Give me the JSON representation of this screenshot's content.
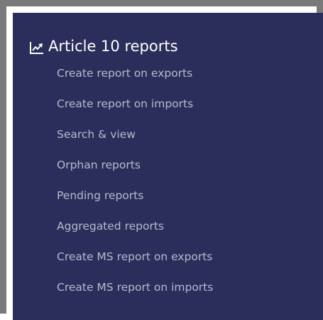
{
  "section": {
    "title": "Article 10 reports",
    "icon": "line-chart-icon"
  },
  "menu": {
    "items": [
      {
        "label": "Create report on exports"
      },
      {
        "label": "Create report on imports"
      },
      {
        "label": "Search & view"
      },
      {
        "label": "Orphan reports"
      },
      {
        "label": "Pending reports"
      },
      {
        "label": "Aggregated reports"
      },
      {
        "label": "Create MS report on exports"
      },
      {
        "label": "Create MS report on imports"
      }
    ]
  },
  "colors": {
    "panel_background": "#2b2e5a",
    "frame_border": "#7a7a7a",
    "title_text": "#ffffff",
    "item_text": "#b7b9cf"
  }
}
